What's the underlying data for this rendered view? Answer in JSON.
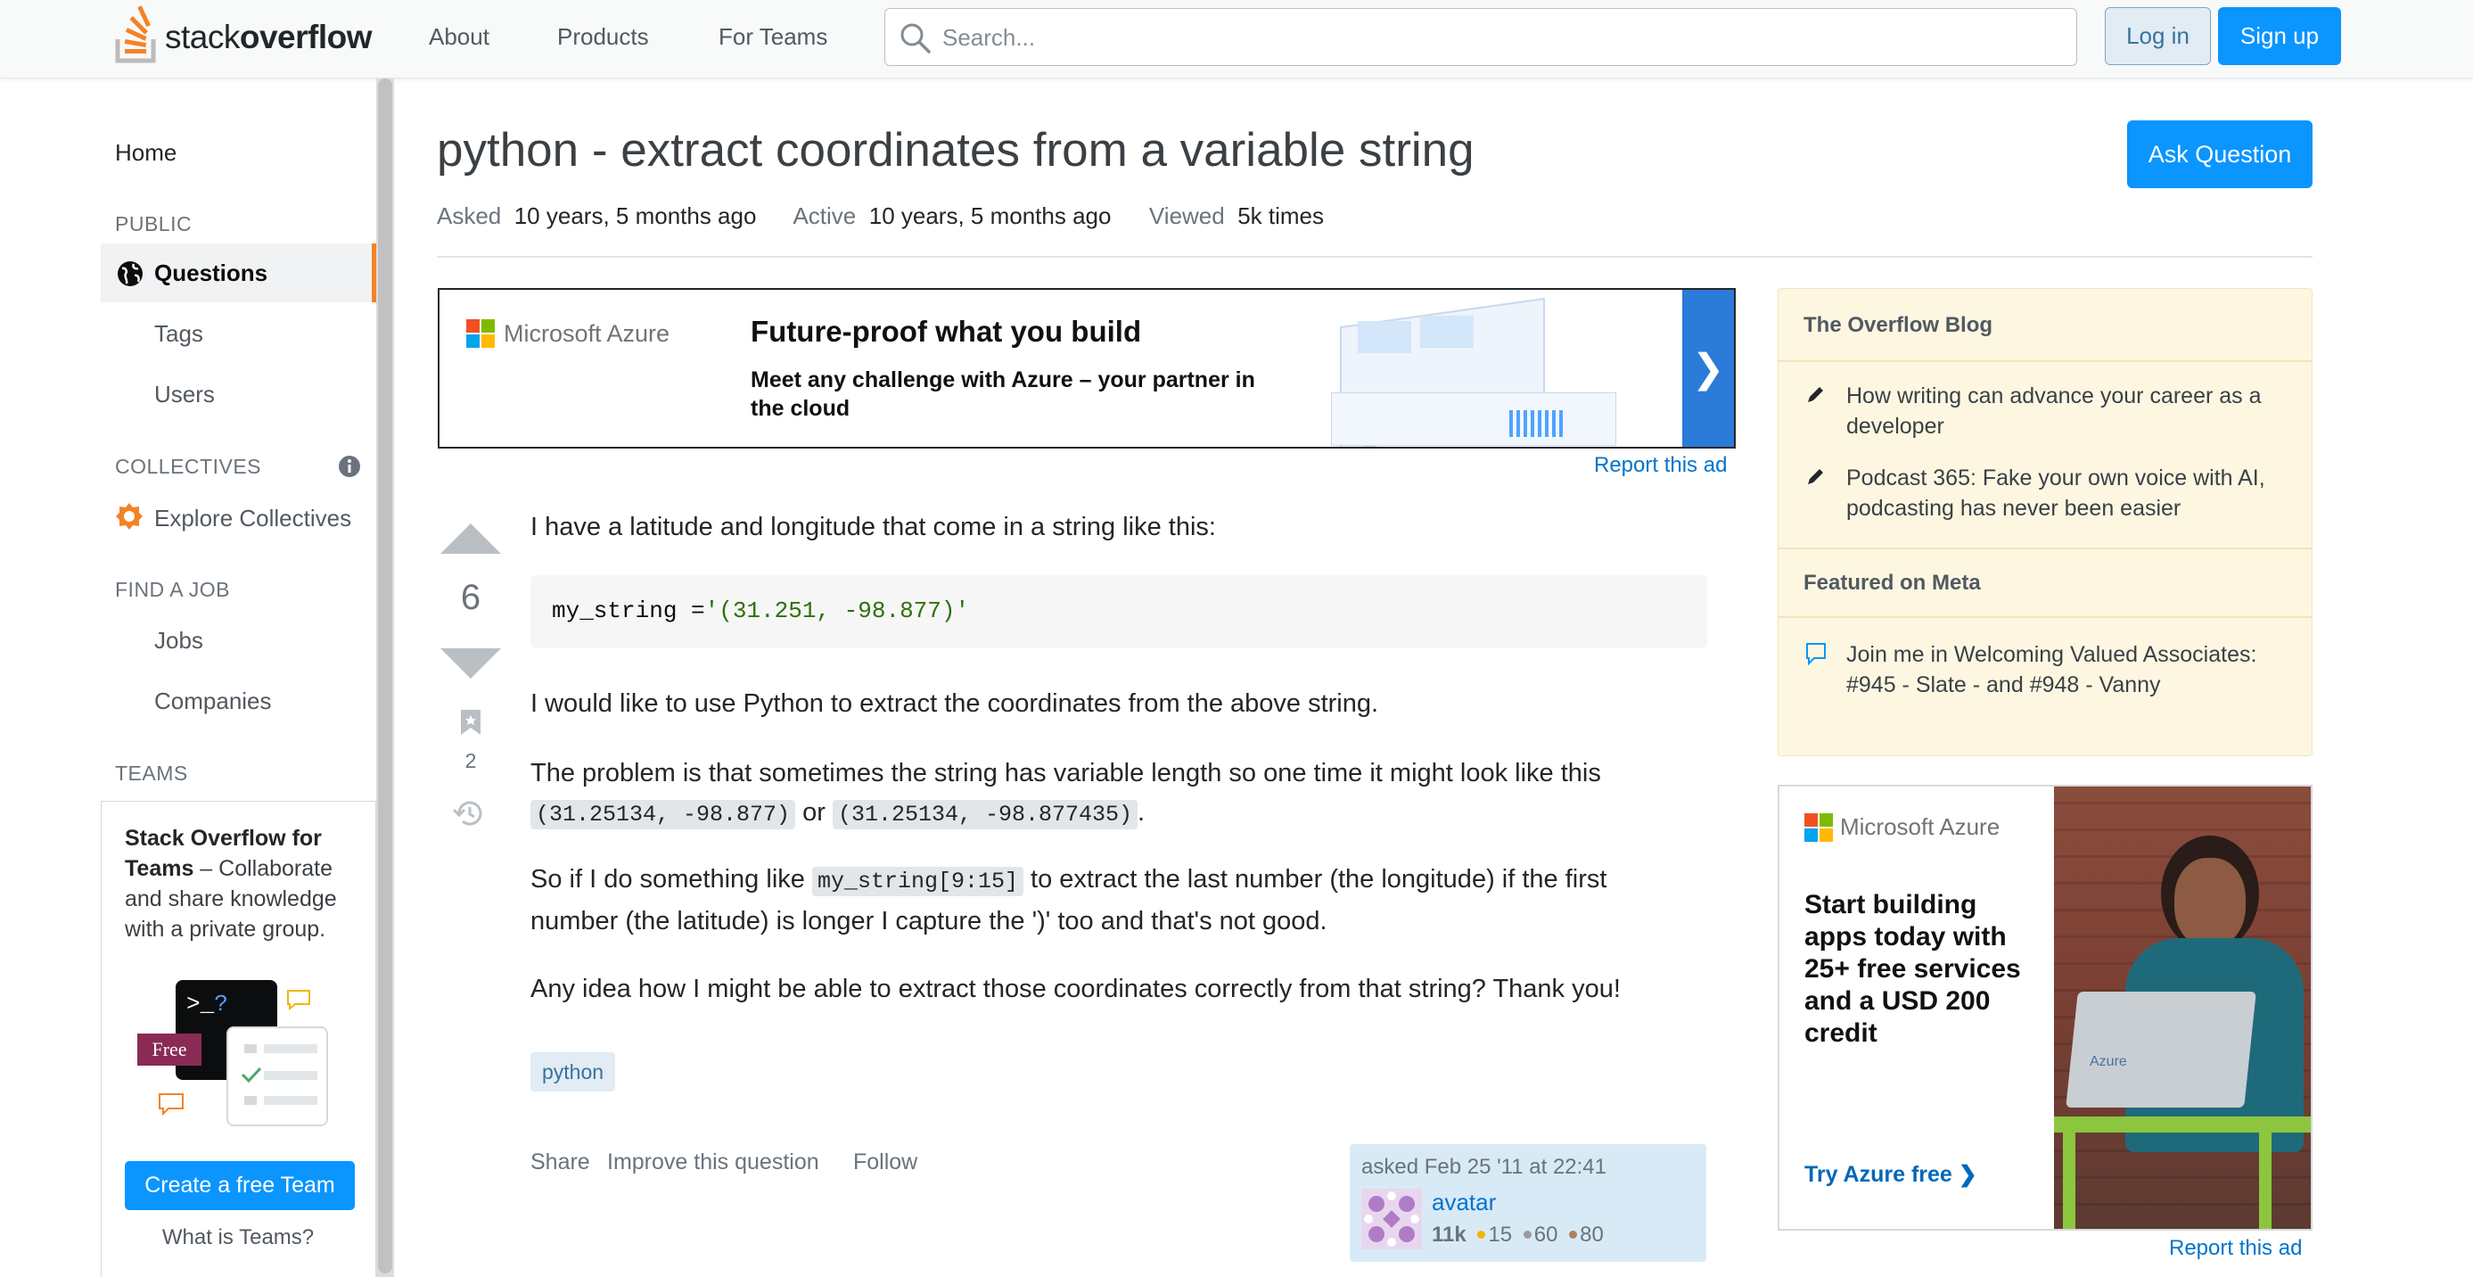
{
  "header": {
    "logo_light": "stack",
    "logo_bold": "overflow",
    "nav": [
      "About",
      "Products",
      "For Teams"
    ],
    "search_placeholder": "Search...",
    "login": "Log in",
    "signup": "Sign up"
  },
  "sidebar": {
    "home": "Home",
    "public_label": "PUBLIC",
    "questions": "Questions",
    "tags": "Tags",
    "users": "Users",
    "collectives_label": "COLLECTIVES",
    "explore_collectives": "Explore Collectives",
    "findjob_label": "FIND A JOB",
    "jobs": "Jobs",
    "companies": "Companies",
    "teams_label": "TEAMS",
    "teams_promo_bold": "Stack Overflow for Teams",
    "teams_promo_rest": " – Collaborate and share knowledge with a private group.",
    "free_badge": "Free",
    "create_team": "Create a free Team",
    "what_is_teams": "What is Teams?"
  },
  "question": {
    "title": "python - extract coordinates from a variable string",
    "asked_label": "Asked",
    "asked_value": "10 years, 5 months ago",
    "active_label": "Active",
    "active_value": "10 years, 5 months ago",
    "viewed_label": "Viewed",
    "viewed_value": "5k times",
    "ask_button": "Ask Question",
    "score": "6",
    "bookmarks": "2",
    "p1": "I have a latitude and longitude that come in a string like this:",
    "code_prefix": "my_string =",
    "code_string": "'(31.251, -98.877)'",
    "p2": "I would like to use Python to extract the coordinates from the above string.",
    "p3_a": "The problem is that sometimes the string has variable length so one time it might look like this",
    "p3_code1": "(31.25134, -98.877)",
    "p3_or": " or ",
    "p3_code2": "(31.25134, -98.877435)",
    "p3_end": ".",
    "p4_a": "So if I do something like ",
    "p4_code": "my_string[9:15]",
    "p4_b": " to extract the last number (the longitude) if the first",
    "p4_c": "number (the latitude) is longer I capture the ')' too and that's not good.",
    "p5": "Any idea how I might be able to extract those coordinates correctly from that string? Thank you!",
    "tag": "python",
    "menu": [
      "Share",
      "Improve this question",
      "Follow"
    ],
    "asked_on": "asked Feb 25 '11 at 22:41",
    "user_name": "avatar",
    "user_rep": "11k",
    "badge_gold": "15",
    "badge_silver": "60",
    "badge_bronze": "80"
  },
  "ads": {
    "ad1_brand": "Microsoft Azure",
    "ad1_headline": "Future-proof what you build",
    "ad1_sub": "Meet any challenge with Azure – your partner in the cloud",
    "report": "Report this ad",
    "ad2_brand": "Microsoft Azure",
    "ad2_headline": "Start building apps today with 25+ free services and a USD 200 credit",
    "ad2_cta": "Try Azure free ❯",
    "ad2_laptop_sticker": "Azure"
  },
  "right": {
    "blog_title": "The Overflow Blog",
    "blog_items": [
      "How writing can advance your career as a developer",
      "Podcast 365: Fake your own voice with AI, podcasting has never been easier"
    ],
    "meta_title": "Featured on Meta",
    "meta_items": [
      "Join me in Welcoming Valued Associates: #945 - Slate - and #948 - Vanny"
    ]
  },
  "colors": {
    "accent": "#f48225",
    "primary": "#0a95ff",
    "link": "#0074cc",
    "gold": "#f1b600",
    "silver": "#9a9c9f",
    "bronze": "#ab825f"
  }
}
